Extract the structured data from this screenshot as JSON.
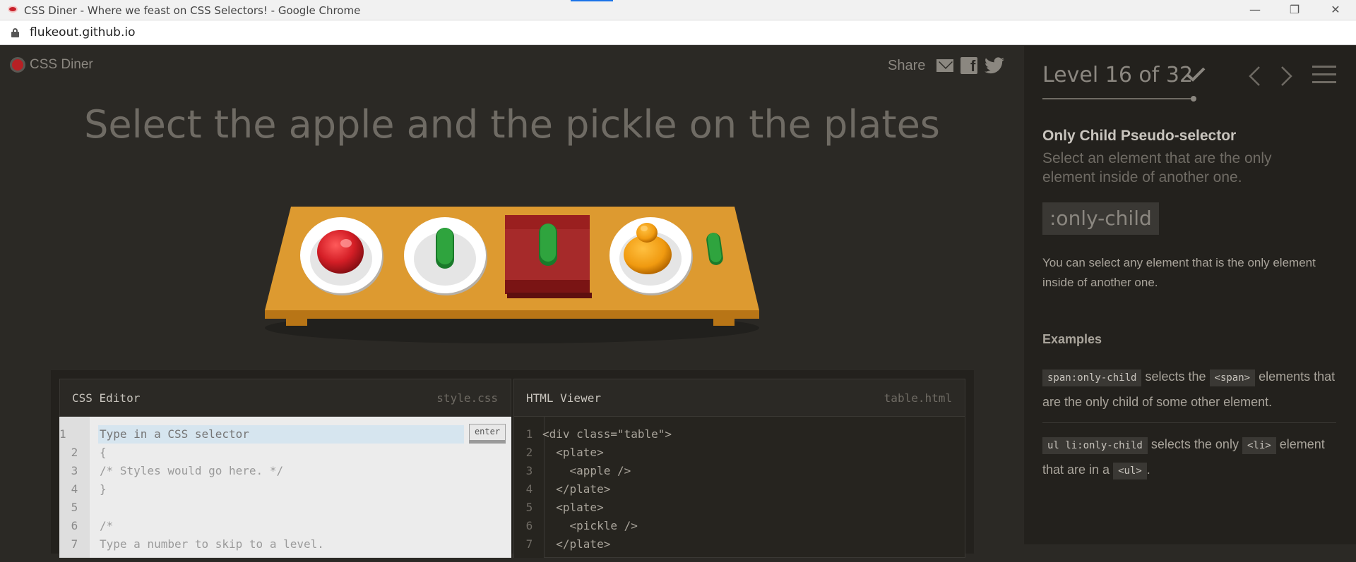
{
  "browser": {
    "window_title": "CSS Diner - Where we feast on CSS Selectors! - Google Chrome",
    "url": "flukeout.github.io",
    "controls": {
      "minimize": "—",
      "maximize": "❐",
      "close": "✕"
    }
  },
  "app": {
    "logo_text": "CSS Diner",
    "share_label": "Share",
    "instruction": "Select the apple and the pickle on the plates"
  },
  "css_editor": {
    "title": "CSS Editor",
    "filename": "style.css",
    "input_placeholder": "Type in a CSS selector",
    "enter_label": "enter",
    "line_numbers": [
      "1",
      "2",
      "3",
      "4",
      "5",
      "6",
      "7"
    ],
    "lines": [
      "",
      "{",
      "/* Styles would go here. */",
      "}",
      "",
      "/*",
      "Type a number to skip to a level."
    ]
  },
  "html_viewer": {
    "title": "HTML Viewer",
    "filename": "table.html",
    "line_numbers": [
      "1",
      "2",
      "3",
      "4",
      "5",
      "6",
      "7"
    ],
    "lines": [
      "<div class=\"table\">",
      "  <plate>",
      "    <apple />",
      "  </plate>",
      "  <plate>",
      "    <pickle />",
      "  </plate>"
    ]
  },
  "sidebar": {
    "level_text": "Level 16 of 32",
    "level_progress_fraction": 0.5,
    "selector_name": "Only Child Pseudo-selector",
    "selector_title": "Select an element that are the only element inside of another one.",
    "syntax": ":only-child",
    "hint": "You can select any element that is the only element inside of another one.",
    "examples_heading": "Examples",
    "example1": {
      "code": "span:only-child",
      "text1": "selects the",
      "code2": "<span>",
      "text2": "elements that are the only child of some other element."
    },
    "example2": {
      "code": "ul li:only-child",
      "text1": "selects the only",
      "code2": "<li>",
      "text2": "element that are in a",
      "code3": "<ul>",
      "text3": "."
    }
  },
  "colors": {
    "background": "#2b2925",
    "sidebar_bg": "#23211d",
    "table": "#d6962c",
    "apple": "#c8202a",
    "pickle": "#2e9a3a",
    "orange": "#e8900c",
    "bento": "#8a1f1f"
  }
}
